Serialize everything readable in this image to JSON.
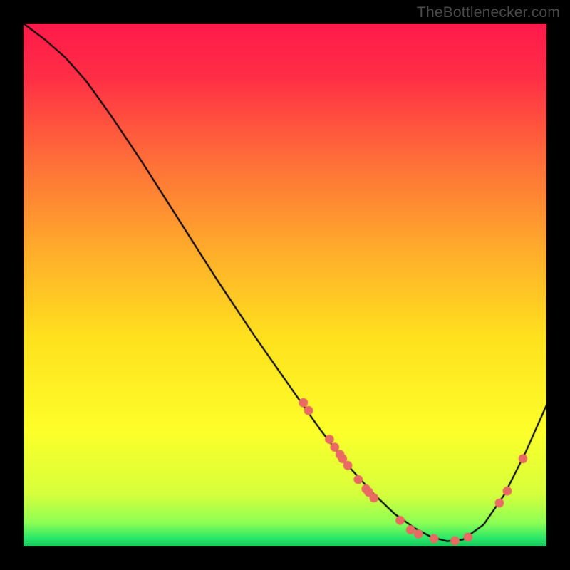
{
  "watermark": {
    "text": "TheBottlenecker.com"
  },
  "chart_data": {
    "type": "line",
    "title": "",
    "xlabel": "",
    "ylabel": "",
    "xlim": [
      0,
      100
    ],
    "ylim": [
      0,
      100
    ],
    "grid": false,
    "legend": false,
    "background_gradient": {
      "stops": [
        {
          "t": 0.0,
          "color": "#ff1a4b"
        },
        {
          "t": 0.1,
          "color": "#ff2e46"
        },
        {
          "t": 0.25,
          "color": "#ff6a3a"
        },
        {
          "t": 0.45,
          "color": "#ffb22a"
        },
        {
          "t": 0.6,
          "color": "#ffe11e"
        },
        {
          "t": 0.78,
          "color": "#fdff2a"
        },
        {
          "t": 0.9,
          "color": "#d6ff3c"
        },
        {
          "t": 0.955,
          "color": "#8cff55"
        },
        {
          "t": 0.985,
          "color": "#28e76a"
        },
        {
          "t": 1.0,
          "color": "#17c95c"
        }
      ]
    },
    "series": [
      {
        "name": "bottleneck-curve",
        "color": "#000000",
        "width": 2.2,
        "x": [
          0,
          4,
          8,
          12,
          17,
          23,
          30,
          37,
          44,
          51,
          57,
          62,
          67,
          71,
          75,
          78,
          81,
          84,
          88,
          92,
          96,
          100
        ],
        "y": [
          100,
          97,
          93.5,
          89,
          82,
          73,
          62,
          51,
          40.5,
          30.5,
          22,
          15.5,
          10,
          6.2,
          3.4,
          1.8,
          1.0,
          1.3,
          4.2,
          10,
          18,
          27
        ]
      }
    ],
    "scatter": {
      "name": "sample-points",
      "color": "#e86a63",
      "radius": 6.4,
      "points": [
        {
          "x": 53.5,
          "y": 27.5
        },
        {
          "x": 54.5,
          "y": 26.0
        },
        {
          "x": 58.5,
          "y": 20.5
        },
        {
          "x": 59.5,
          "y": 19.0
        },
        {
          "x": 60.5,
          "y": 17.6
        },
        {
          "x": 61.0,
          "y": 16.8
        },
        {
          "x": 62.0,
          "y": 15.5
        },
        {
          "x": 64.0,
          "y": 12.8
        },
        {
          "x": 65.5,
          "y": 11.0
        },
        {
          "x": 66.0,
          "y": 10.4
        },
        {
          "x": 67.0,
          "y": 9.3
        },
        {
          "x": 72.0,
          "y": 5.0
        },
        {
          "x": 74.0,
          "y": 3.2
        },
        {
          "x": 75.5,
          "y": 2.4
        },
        {
          "x": 78.5,
          "y": 1.5
        },
        {
          "x": 82.5,
          "y": 1.1
        },
        {
          "x": 85.0,
          "y": 1.8
        },
        {
          "x": 91.0,
          "y": 8.3
        },
        {
          "x": 92.5,
          "y": 10.6
        },
        {
          "x": 95.5,
          "y": 16.8
        }
      ]
    }
  }
}
